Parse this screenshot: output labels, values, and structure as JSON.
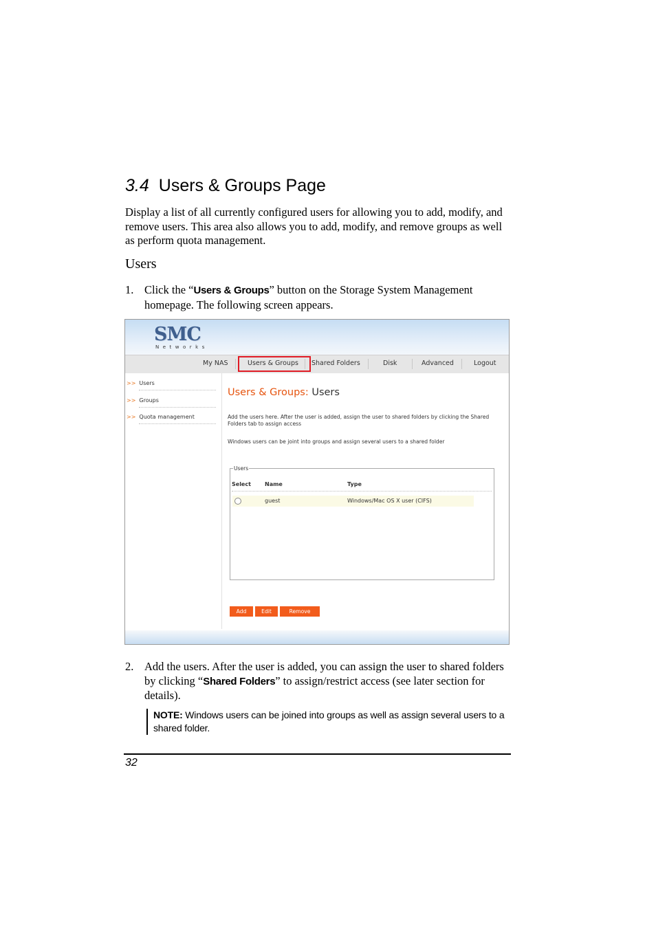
{
  "section": {
    "number": "3.4",
    "title": "Users & Groups Page",
    "intro": "Display a list of all currently configured users for allowing you to add, modify, and remove users. This area also allows you to add, modify, and remove groups as well as perform quota management."
  },
  "subheading": "Users",
  "steps": [
    {
      "number": "1.",
      "before": "Click the “",
      "bold": "Users & Groups",
      "after": "” button on the Storage System Management homepage. The following screen appears."
    },
    {
      "number": "2.",
      "before": "Add the users. After the user is added, you can assign the user to shared folders by clicking “",
      "bold": "Shared Folders",
      "after": "” to assign/restrict access (see later section for details)."
    }
  ],
  "screenshot": {
    "logo": {
      "brand": "SMC",
      "tagline": "Networks"
    },
    "nav": [
      "My NAS",
      "Users & Groups",
      "Shared Folders",
      "Disk",
      "Advanced",
      "Logout"
    ],
    "highlight_color": "#e01a24",
    "accent_color": "#e6540f",
    "sidebar": [
      "Users",
      "Groups",
      "Quota management"
    ],
    "sidebar_arrow": ">>",
    "page_title": {
      "main": "Users & Groups:",
      "sub": "Users"
    },
    "desc1": "Add the users here. After the user is added, assign the user to shared folders by clicking the Shared Folders tab to assign access",
    "desc2": "Windows users can be joint into groups and assign several users to a shared folder",
    "fieldset_legend": "Users",
    "table": {
      "headers": [
        "Select",
        "Name",
        "Type"
      ],
      "rows": [
        {
          "name": "guest",
          "type": "Windows/Mac OS X user (CIFS)"
        }
      ]
    },
    "buttons": [
      "Add",
      "Edit",
      "Remove"
    ],
    "button_color": "#f25c1c"
  },
  "note": {
    "label": "NOTE:",
    "text": "Windows users can be joined into groups as well as assign several users to a shared folder."
  },
  "page_number": "32"
}
